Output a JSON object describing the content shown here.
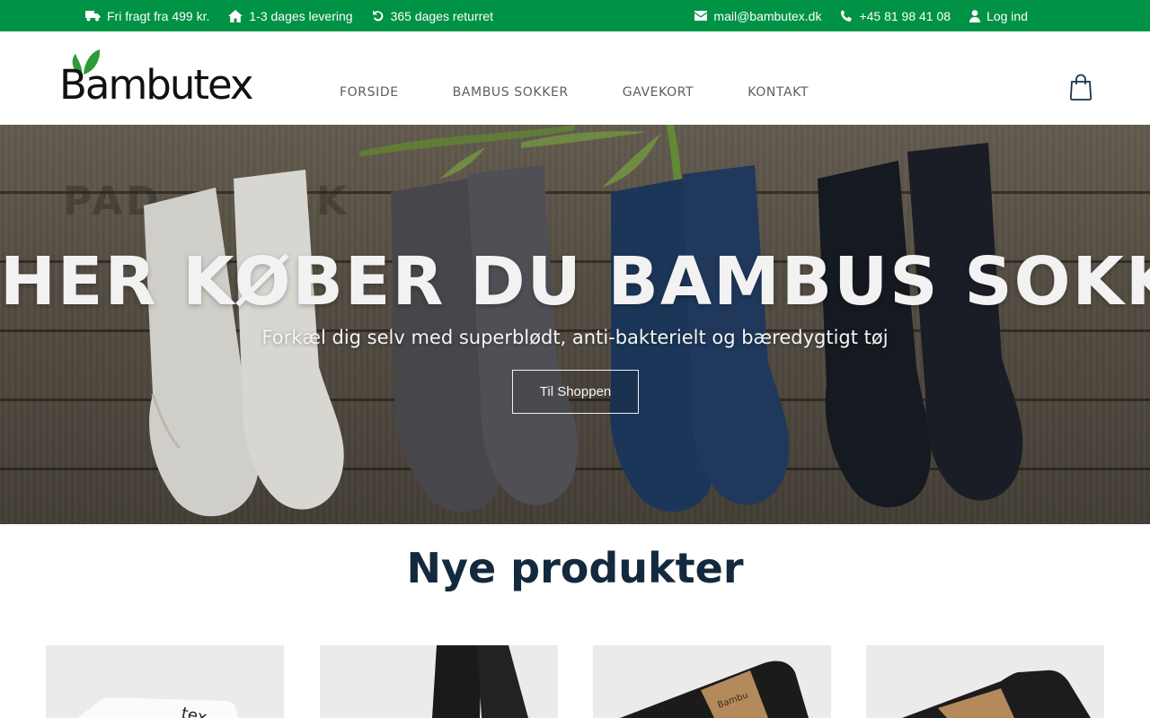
{
  "topbar": {
    "shipping": "Fri fragt fra 499 kr.",
    "delivery": "1-3 dages levering",
    "returns": "365 dages returret",
    "email": "mail@bambutex.dk",
    "phone": "+45 81 98 41 08",
    "login": "Log ind",
    "icons": [
      "truck-icon",
      "home-icon",
      "undo-icon",
      "envelope-icon",
      "phone-icon",
      "user-icon"
    ]
  },
  "brand": {
    "name": "Bambutex",
    "leaf_color": "#2e9a3a"
  },
  "nav": {
    "items": [
      "FORSIDE",
      "BAMBUS SOKKER",
      "GAVEKORT",
      "KONTAKT"
    ]
  },
  "cart": {
    "icon": "shopping-bag-icon"
  },
  "hero": {
    "title": "HER KØBER DU BAMBUS SOKKER",
    "subtitle": "Forkæl dig selv med superblødt, anti-bakterielt og bæredygtigt tøj",
    "button_label": "Til Shoppen"
  },
  "products": {
    "heading": "Nye produkter",
    "items": [
      {
        "image": "gift-card-image"
      },
      {
        "image": "black-socks-image"
      },
      {
        "image": "black-socks-pack-image"
      },
      {
        "image": "black-ankle-socks-image"
      }
    ]
  },
  "colors": {
    "topbar_bg": "#009245",
    "heading": "#13293d",
    "nav_text": "#5a5f66"
  }
}
